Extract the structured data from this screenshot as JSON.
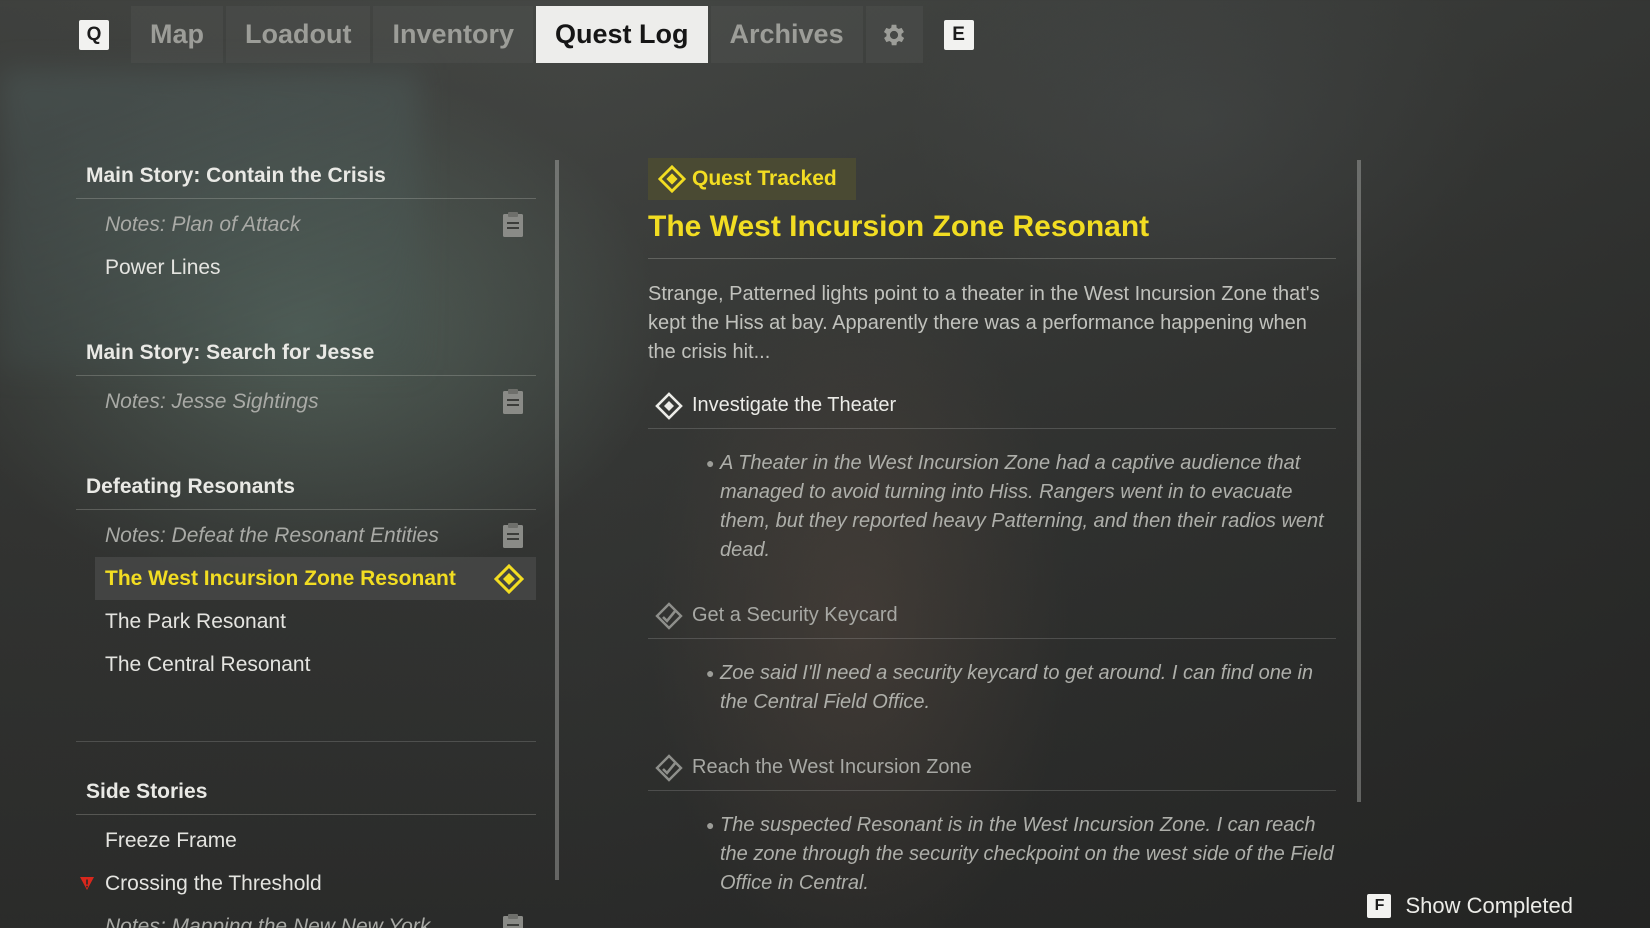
{
  "topbar": {
    "left_key": "Q",
    "right_key": "E",
    "tabs": [
      {
        "label": "Map"
      },
      {
        "label": "Loadout"
      },
      {
        "label": "Inventory"
      },
      {
        "label": "Quest Log"
      },
      {
        "label": "Archives"
      }
    ],
    "active_tab": "Quest Log",
    "settings_icon": "gear-icon"
  },
  "quests": {
    "main_crisis": {
      "title": "Main Story: Contain the Crisis",
      "note": "Notes: Plan of Attack",
      "items": [
        "Power Lines"
      ]
    },
    "main_jesse": {
      "title": "Main Story: Search for Jesse",
      "note": "Notes: Jesse Sightings"
    },
    "resonants": {
      "title": "Defeating Resonants",
      "note": "Notes: Defeat the Resonant Entities",
      "selected": "The West Incursion Zone Resonant",
      "items": [
        "The Park Resonant",
        "The Central Resonant"
      ]
    },
    "side": {
      "title": "Side Stories",
      "items": [
        "Freeze Frame",
        "Crossing the Threshold"
      ],
      "note": "Notes: Mapping the New New York"
    }
  },
  "detail": {
    "badge": "Quest Tracked",
    "title": "The West Incursion Zone Resonant",
    "description": "Strange, Patterned lights point to a theater in the West Incursion Zone that's kept the Hiss at bay. Apparently there was a performance happening when the crisis hit...",
    "objectives": [
      {
        "label": "Investigate the Theater",
        "state": "active",
        "note": "A Theater in the West Incursion Zone had a captive audience that managed to avoid turning into Hiss. Rangers went in to evacuate them, but they reported heavy Patterning, and then their radios went dead."
      },
      {
        "label": "Get a Security Keycard",
        "state": "completed",
        "note": "Zoe said I'll need a security keycard to get around. I can find one in the Central Field Office."
      },
      {
        "label": "Reach the West Incursion Zone",
        "state": "completed",
        "note": "The suspected Resonant is in the West Incursion Zone. I can reach the zone through the security checkpoint on the west side of the Field Office in Central."
      }
    ]
  },
  "footer": {
    "key": "F",
    "label": "Show Completed"
  },
  "colors": {
    "accent": "#f2dd22",
    "warning": "#d9271c"
  }
}
